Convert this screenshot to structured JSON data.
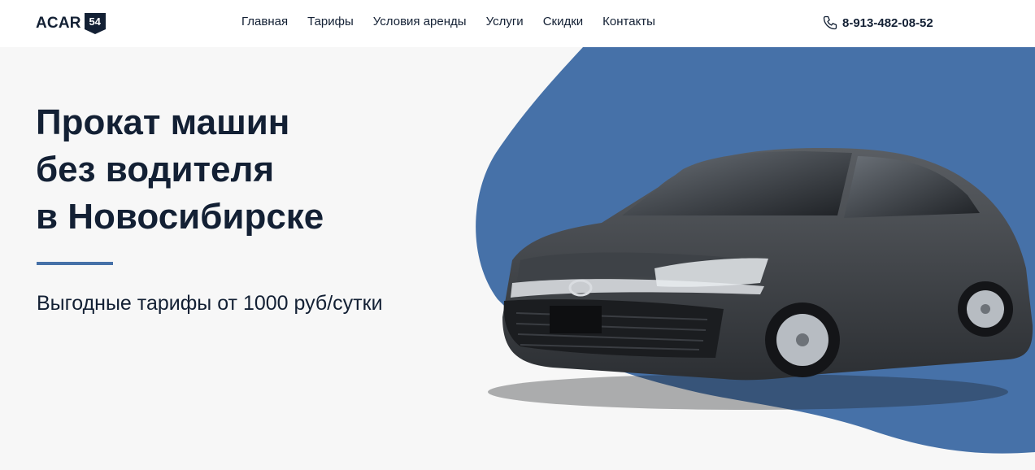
{
  "header": {
    "logo_text": "ACAR",
    "logo_badge": "54",
    "nav": [
      "Главная",
      "Тарифы",
      "Условия аренды",
      "Услуги",
      "Скидки",
      "Контакты"
    ],
    "phone": "8-913-482-08-52",
    "phone_icon": "phone-icon"
  },
  "hero": {
    "title_lines": [
      "Прокат машин",
      "без водителя",
      "в Новосибирске"
    ],
    "subtitle": "Выгодные тарифы от 1000 руб/сутки",
    "image": "car-photo"
  },
  "colors": {
    "accent": "#4671a8",
    "dark": "#132034",
    "background": "#f7f7f7",
    "header_bg": "#ffffff"
  }
}
